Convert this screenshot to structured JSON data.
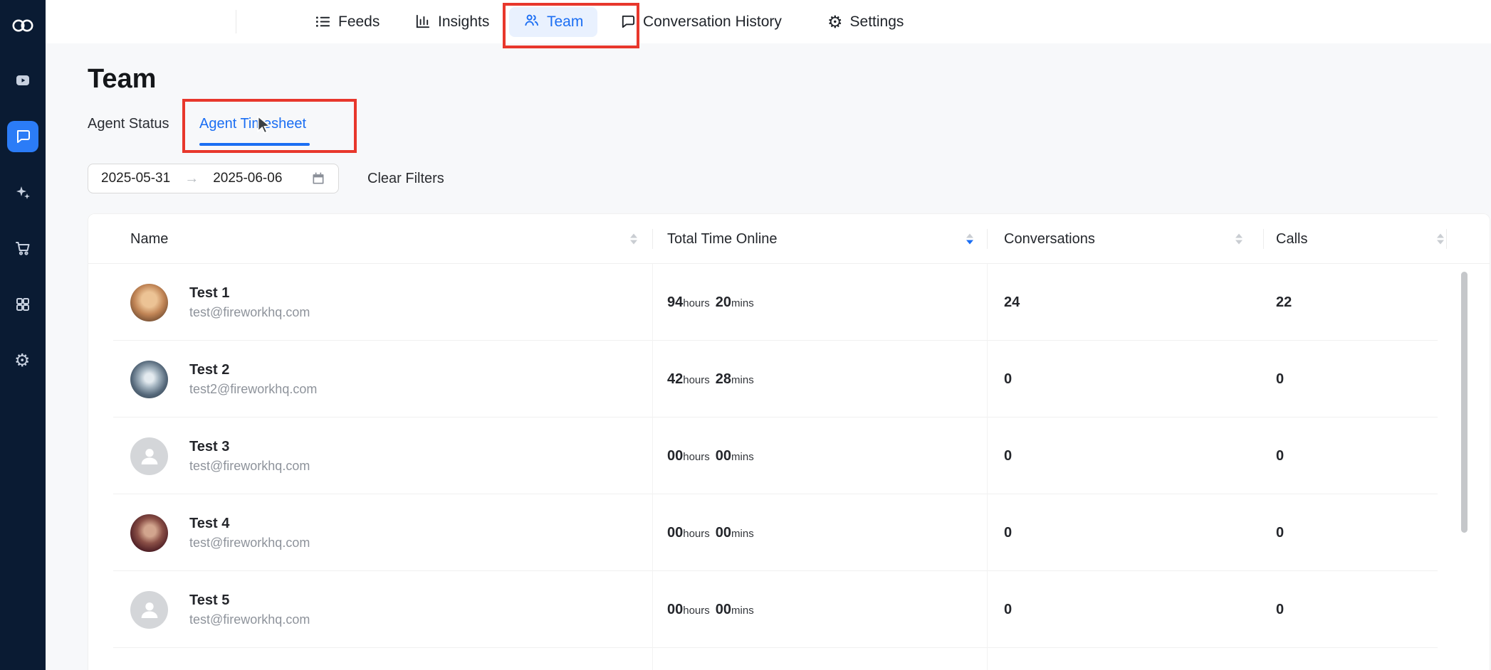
{
  "colors": {
    "accent": "#1b6ef3",
    "annotation": "#e8372c",
    "sidebar-bg": "#0a1b33",
    "sidebar-active": "#2b7cf7",
    "page-bg": "#f7f8fa",
    "nav-active-bg": "#e9f1fe"
  },
  "sidebar": {
    "icons": [
      "logo",
      "video",
      "chat-active",
      "sparkles",
      "cart",
      "apps-grid",
      "settings"
    ]
  },
  "topnav": {
    "feeds": "Feeds",
    "insights": "Insights",
    "team": "Team",
    "conversation_history": "Conversation History",
    "settings": "Settings"
  },
  "page": {
    "title": "Team",
    "tab_agent_status": "Agent Status",
    "tab_agent_timesheet": "Agent Timesheet",
    "date_start": "2025-05-31",
    "date_separator": "→",
    "date_end": "2025-06-06",
    "clear_filters": "Clear Filters"
  },
  "table": {
    "columns": {
      "name": "Name",
      "time": "Total Time Online",
      "conversations": "Conversations",
      "calls": "Calls"
    },
    "units": {
      "hours": "hours",
      "mins": "mins"
    },
    "rows": [
      {
        "name": "Test 1",
        "email": "test@fireworkhq.com",
        "hours": "94",
        "mins": "20",
        "conversations": "24",
        "calls": "22",
        "avatar": "cartoon-man-photo"
      },
      {
        "name": "Test 2",
        "email": "test2@fireworkhq.com",
        "hours": "42",
        "mins": "28",
        "conversations": "0",
        "calls": "0",
        "avatar": "dandelion-photo"
      },
      {
        "name": "Test 3",
        "email": "test@fireworkhq.com",
        "hours": "00",
        "mins": "00",
        "conversations": "0",
        "calls": "0",
        "avatar": "placeholder"
      },
      {
        "name": "Test 4",
        "email": "test@fireworkhq.com",
        "hours": "00",
        "mins": "00",
        "conversations": "0",
        "calls": "0",
        "avatar": "woman-photo"
      },
      {
        "name": "Test 5",
        "email": "test@fireworkhq.com",
        "hours": "00",
        "mins": "00",
        "conversations": "0",
        "calls": "0",
        "avatar": "placeholder"
      }
    ]
  }
}
